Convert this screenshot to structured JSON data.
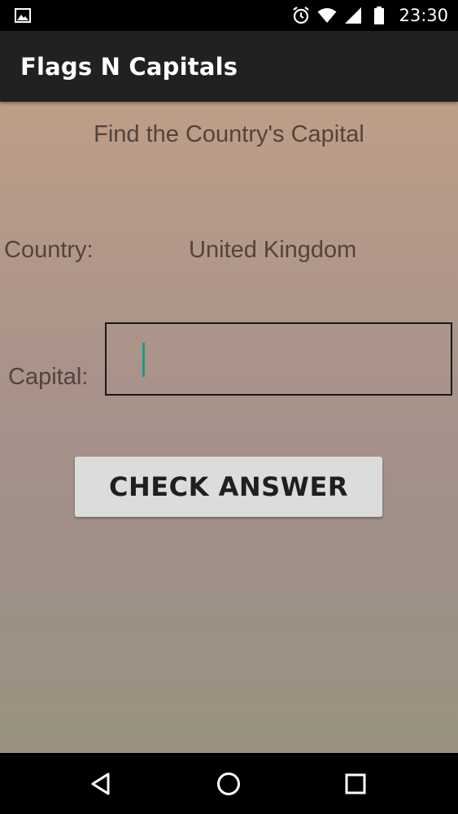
{
  "status_bar": {
    "time": "23:30",
    "icons": [
      "image-notification-icon",
      "alarm-icon",
      "wifi-icon",
      "signal-icon",
      "battery-icon"
    ]
  },
  "app": {
    "title": "Flags N Capitals"
  },
  "quiz": {
    "prompt": "Find the Country's Capital",
    "country_label": "Country:",
    "country_value": "United Kingdom",
    "capital_label": "Capital:",
    "capital_input_value": "",
    "check_button_label": "CHECK ANSWER"
  },
  "nav_bar": {
    "icons": [
      "back-icon",
      "home-icon",
      "recents-icon"
    ]
  },
  "colors": {
    "action_bar": "#212121",
    "text": "#54433c",
    "caret": "#1b998a",
    "button": "#dcdcdc"
  }
}
